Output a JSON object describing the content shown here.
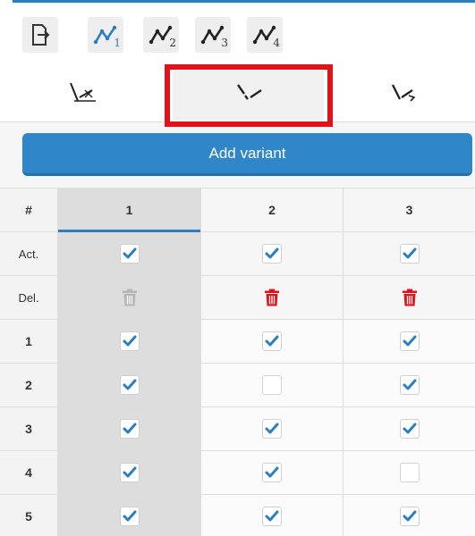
{
  "toolbar": {
    "curve_buttons": [
      {
        "sub": "1",
        "active": true
      },
      {
        "sub": "2",
        "active": false
      },
      {
        "sub": "3",
        "active": false
      },
      {
        "sub": "4",
        "active": false
      }
    ]
  },
  "add_variant_label": "Add variant",
  "table": {
    "corner": "#",
    "columns": [
      "1",
      "2",
      "3"
    ],
    "act_label": "Act.",
    "del_label": "Del.",
    "act": [
      true,
      true,
      true
    ],
    "del_enabled": [
      false,
      true,
      true
    ],
    "rows": [
      {
        "label": "1",
        "checks": [
          true,
          true,
          true
        ]
      },
      {
        "label": "2",
        "checks": [
          true,
          false,
          true
        ]
      },
      {
        "label": "3",
        "checks": [
          true,
          true,
          true
        ]
      },
      {
        "label": "4",
        "checks": [
          true,
          true,
          false
        ]
      },
      {
        "label": "5",
        "checks": [
          true,
          true,
          true
        ]
      }
    ]
  },
  "colors": {
    "accent": "#2b7fc1",
    "delete_active": "#e0121a",
    "delete_inactive": "#b5b5b5",
    "highlight": "#e0121a"
  }
}
